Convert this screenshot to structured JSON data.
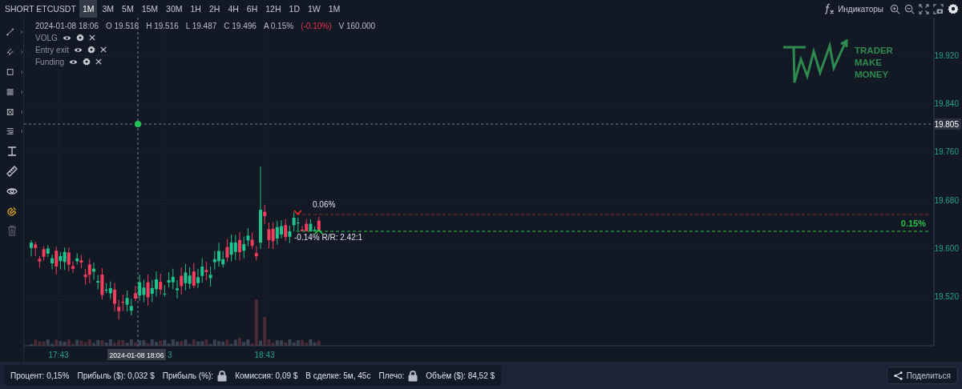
{
  "symbol": "SHORT ETCUSDT",
  "timeframes": [
    {
      "label": "1M",
      "selected": true
    },
    {
      "label": "3M",
      "selected": false
    },
    {
      "label": "5M",
      "selected": false
    },
    {
      "label": "15M",
      "selected": false
    },
    {
      "label": "30M",
      "selected": false
    },
    {
      "label": "1H",
      "selected": false
    },
    {
      "label": "2H",
      "selected": false
    },
    {
      "label": "4H",
      "selected": false
    },
    {
      "label": "6H",
      "selected": false
    },
    {
      "label": "12H",
      "selected": false
    },
    {
      "label": "1D",
      "selected": false
    },
    {
      "label": "1W",
      "selected": false
    },
    {
      "label": "1M",
      "selected": false
    }
  ],
  "toolbar": {
    "indicators_label": "Индикаторы"
  },
  "tools": [
    {
      "kind": "line",
      "submenu": true,
      "active": false,
      "disabled": false
    },
    {
      "kind": "parallel",
      "submenu": true,
      "active": false,
      "disabled": false
    },
    {
      "kind": "rectangle",
      "submenu": true,
      "active": false,
      "disabled": false
    },
    {
      "kind": "fib",
      "submenu": true,
      "active": false,
      "disabled": false
    },
    {
      "kind": "pattern",
      "submenu": true,
      "active": false,
      "disabled": false
    },
    {
      "kind": "levels",
      "submenu": true,
      "active": false,
      "disabled": false
    },
    {
      "kind": "measure",
      "submenu": false,
      "active": false,
      "disabled": false
    },
    {
      "kind": "ruler",
      "submenu": false,
      "active": false,
      "disabled": false
    },
    {
      "kind": "eye",
      "submenu": false,
      "active": false,
      "disabled": false
    },
    {
      "kind": "magnet",
      "submenu": false,
      "active": true,
      "disabled": false
    },
    {
      "kind": "trash",
      "submenu": false,
      "active": false,
      "disabled": true
    }
  ],
  "legend": [
    {
      "text": "2024-01-08 18:06",
      "negative": false
    },
    {
      "text": "O 19.516",
      "negative": false
    },
    {
      "text": "H 19.516",
      "negative": false
    },
    {
      "text": "L 19.487",
      "negative": false
    },
    {
      "text": "C 19.496",
      "negative": false
    },
    {
      "text": "A 0.15%",
      "negative": false
    },
    {
      "text": "(-0.10%)",
      "negative": true
    },
    {
      "text": "V 160.000",
      "negative": false
    }
  ],
  "indicators": [
    {
      "name": "VOLG"
    },
    {
      "name": "Entry exit"
    },
    {
      "name": "Funding"
    }
  ],
  "logo": {
    "lines": [
      "TRADER",
      "MAKE",
      "MONEY"
    ]
  },
  "price_axis": {
    "ticks": [
      "19.920",
      "19.840",
      "19.760",
      "19.680",
      "19.600",
      "19.520"
    ],
    "crosshair_label": "19.805"
  },
  "time_axis": {
    "labels": [
      "17:43",
      "18:43"
    ],
    "partial_label": "3",
    "crosshair_label": "2024-01-08 18:06"
  },
  "position": {
    "target_label": "0.06%",
    "profit_label": "0.15%",
    "stop_label": "-0.14% R/R: 2.42:1"
  },
  "stats": [
    {
      "text": "Процент: 0,15%",
      "locked": false
    },
    {
      "text": "Прибыль ($): 0,032 $",
      "locked": false
    },
    {
      "text": "Прибыль (%):",
      "locked": true
    },
    {
      "text": "Комиссия: 0,09 $",
      "locked": false
    },
    {
      "text": "В сделке: 5м, 45с",
      "locked": false
    },
    {
      "text": "Плечо:",
      "locked": true
    },
    {
      "text": "Объём ($): 84,52 $",
      "locked": false
    }
  ],
  "share_button": "Поделиться"
}
